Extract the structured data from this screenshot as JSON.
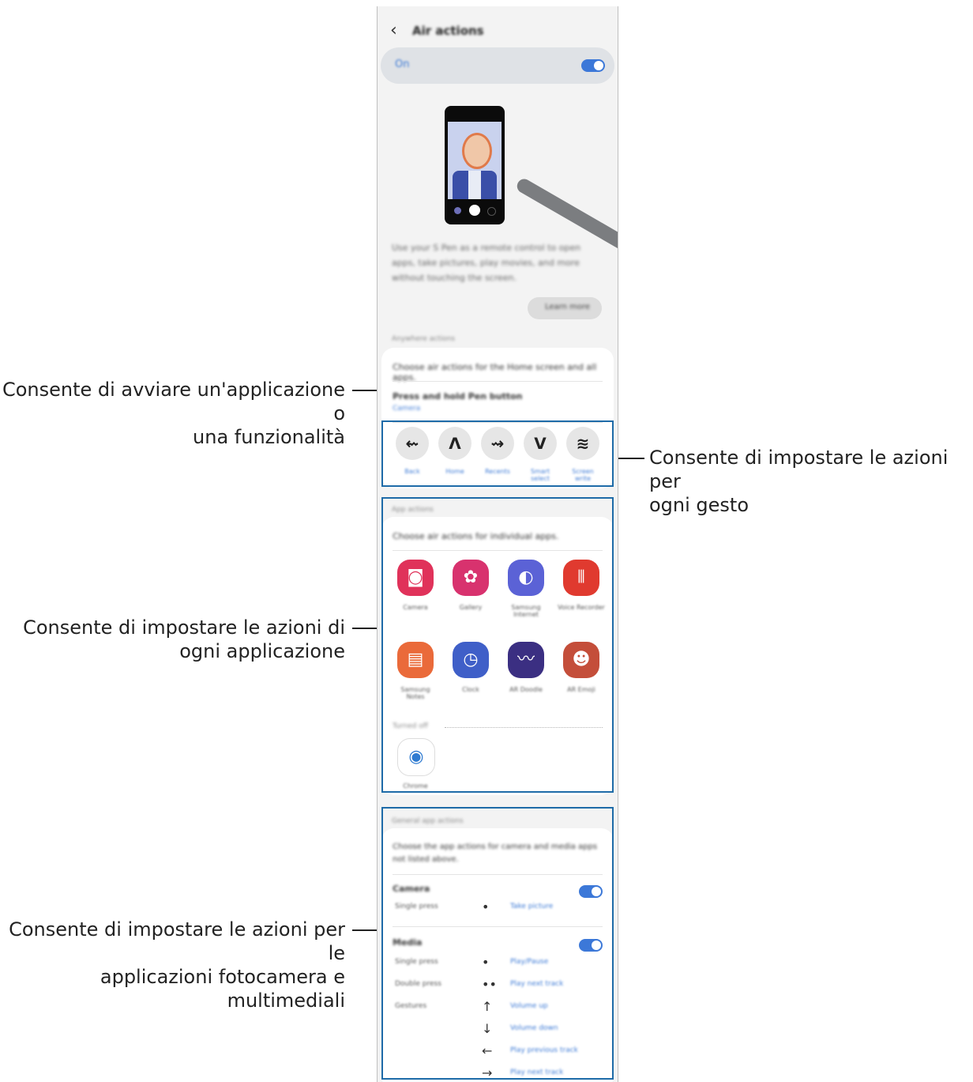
{
  "callouts": {
    "app_feature": [
      "Consente di avviare un'applicazione o",
      "una funzionalità"
    ],
    "gestures": [
      "Consente di impostare le azioni per",
      "ogni gesto"
    ],
    "each_app": [
      "Consente di impostare le azioni di",
      "ogni applicazione"
    ],
    "camera_media": [
      "Consente di impostare le azioni per le",
      "applicazioni fotocamera e",
      "multimediali"
    ]
  },
  "screen": {
    "back_glyph": "‹",
    "title": "Air actions",
    "on_label": "On",
    "description": "Use your S Pen as a remote control to open apps, take pictures, play movies, and more without touching the screen.",
    "learn_more": "Learn more",
    "anywhere_label": "Anywhere actions",
    "anywhere_desc": "Choose air actions for the Home screen and all apps.",
    "press_hold_title": "Press and hold Pen button",
    "press_hold_value": "Camera",
    "gestures": [
      {
        "glyph": "⇜",
        "label": "Back"
      },
      {
        "glyph": "ᐱ",
        "label": "Home"
      },
      {
        "glyph": "⇝",
        "label": "Recents"
      },
      {
        "glyph": "ᐯ",
        "label": "Smart select"
      },
      {
        "glyph": "≋",
        "label": "Screen write"
      }
    ],
    "app_actions_label": "App actions",
    "app_actions_desc": "Choose air actions for individual apps.",
    "apps": [
      {
        "label": "Camera",
        "icon": "camera-icon",
        "glyph": "◙",
        "color": "#e0325a"
      },
      {
        "label": "Gallery",
        "icon": "gallery-icon",
        "glyph": "✿",
        "color": "#d8326e"
      },
      {
        "label": "Samsung Internet",
        "icon": "internet-icon",
        "glyph": "◐",
        "color": "#5b62d6"
      },
      {
        "label": "Voice Recorder",
        "icon": "voice-recorder-icon",
        "glyph": "⦀",
        "color": "#e03a2f"
      },
      {
        "label": "Samsung Notes",
        "icon": "notes-icon",
        "glyph": "▤",
        "color": "#ea6a3a"
      },
      {
        "label": "Clock",
        "icon": "clock-icon",
        "glyph": "◷",
        "color": "#3f5fc8"
      },
      {
        "label": "AR Doodle",
        "icon": "ar-doodle-icon",
        "glyph": "〰",
        "color": "#3b2f82"
      },
      {
        "label": "AR Emoji",
        "icon": "ar-emoji-icon",
        "glyph": "☻",
        "color": "#c44e3a"
      }
    ],
    "turned_off_label": "Turned off",
    "chrome": {
      "label": "Chrome",
      "icon": "chrome-icon",
      "glyph": "◉",
      "color": "#2f7bd1"
    },
    "general_label": "General app actions",
    "general_desc": "Choose the app actions for camera and media apps not listed above.",
    "camera_title": "Camera",
    "camera_rows": [
      {
        "key": "Single press",
        "glyph": "•",
        "value": "Take picture"
      }
    ],
    "media_title": "Media",
    "media_rows": [
      {
        "key": "Single press",
        "glyph": "•",
        "value": "Play/Pause"
      },
      {
        "key": "Double press",
        "glyph": "••",
        "value": "Play next track"
      },
      {
        "key": "Gestures",
        "glyph": "↑",
        "value": "Volume up"
      },
      {
        "key": "",
        "glyph": "↓",
        "value": "Volume down"
      },
      {
        "key": "",
        "glyph": "←",
        "value": "Play previous track"
      },
      {
        "key": "",
        "glyph": "→",
        "value": "Play next track"
      }
    ]
  },
  "colors": {
    "accent": "#3c78d8",
    "highlight": "#1e6ba8"
  }
}
